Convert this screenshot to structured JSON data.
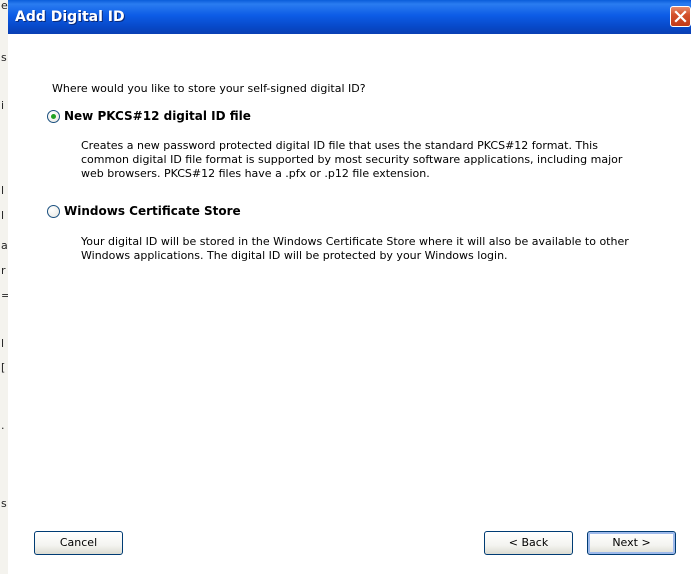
{
  "window": {
    "title": "Add Digital ID"
  },
  "dialog": {
    "prompt": "Where would you like to store your self-signed digital ID?",
    "options": [
      {
        "label": "New PKCS#12 digital ID file",
        "selected": true,
        "description_lines": [
          "Creates a new password protected digital ID file that uses the standard PKCS#12 format. This",
          "common digital ID file format is supported by most security software applications, including major",
          "web browsers. PKCS#12 files have a .pfx or .p12 file extension."
        ]
      },
      {
        "label": "Windows Certificate Store",
        "selected": false,
        "description_lines": [
          "Your digital ID will be stored in the Windows Certificate Store where it will also be available to other",
          "Windows applications. The digital ID will be protected by your Windows login."
        ]
      }
    ]
  },
  "buttons": {
    "cancel": "Cancel",
    "back": "< Back",
    "next": "Next >"
  },
  "colors": {
    "titlebar": "#0a5dd9",
    "radio_selected": "#21a121",
    "close_button": "#c23a17"
  },
  "icons": {
    "close": "close-icon"
  }
}
